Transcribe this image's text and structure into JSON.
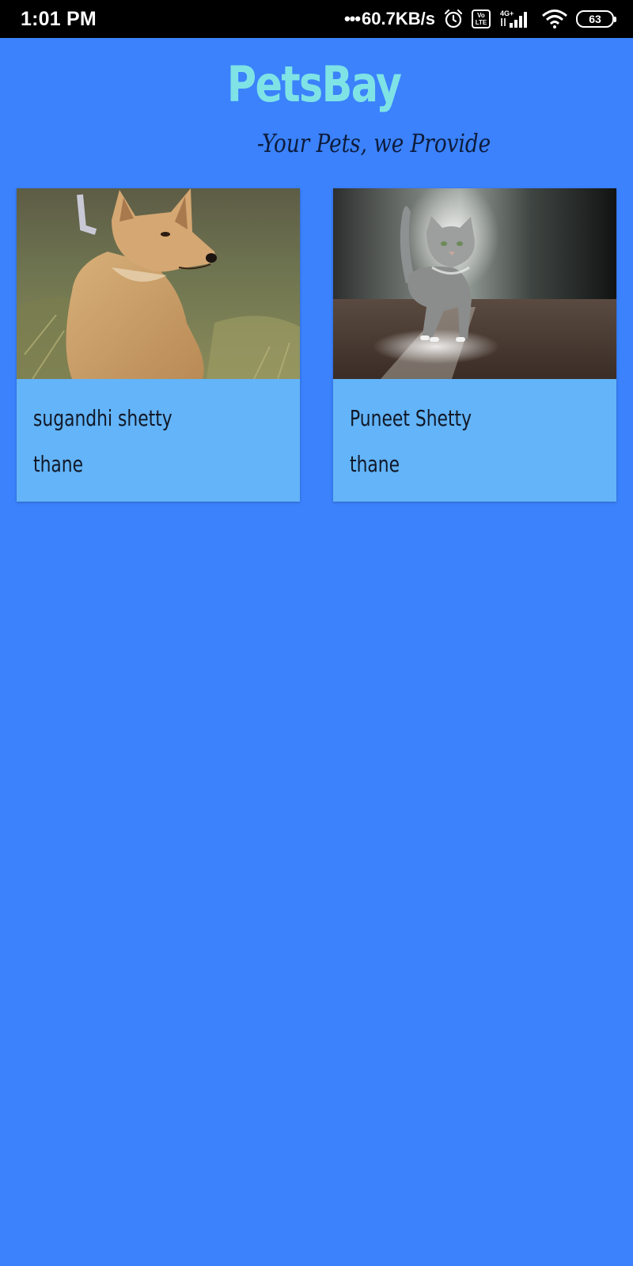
{
  "status_bar": {
    "time": "1:01 PM",
    "speed_dots": "•••",
    "speed": "60.7KB/s",
    "volte_label": "Vo LTE",
    "network": "4G+",
    "battery": "63",
    "icons": [
      "alarm-icon",
      "volte-icon",
      "signal-icon",
      "wifi-icon",
      "battery-icon"
    ]
  },
  "header": {
    "title": "PetsBay",
    "tagline": "-Your Pets, we Provide"
  },
  "listings": [
    {
      "name": "sugandhi shetty",
      "city": "thane",
      "image": "dog-photo"
    },
    {
      "name": "Puneet Shetty",
      "city": "thane",
      "image": "cat-photo"
    }
  ],
  "colors": {
    "background": "#3b82fc",
    "card": "#63b4f8",
    "brand": "#7fe3e6",
    "status_bar": "#000000"
  }
}
